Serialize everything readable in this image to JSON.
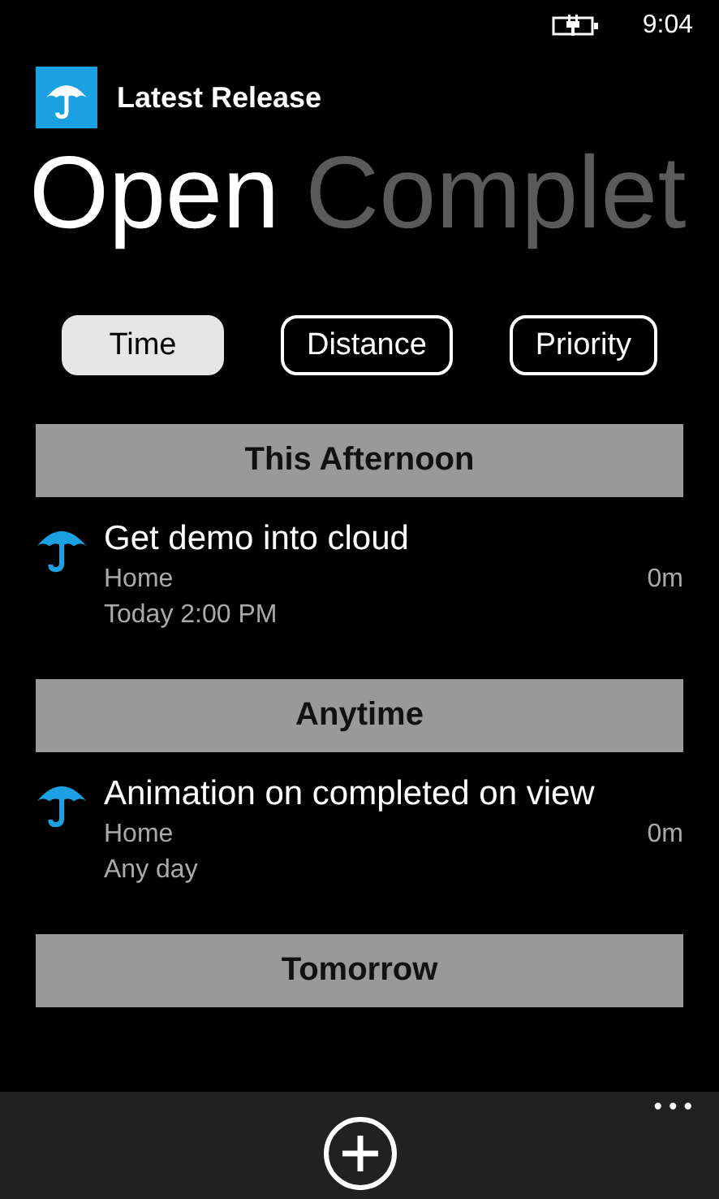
{
  "status_bar": {
    "time": "9:04"
  },
  "app": {
    "title": "Latest Release"
  },
  "pivot": [
    {
      "label": "Open",
      "selected": true
    },
    {
      "label": "Complet",
      "selected": false
    }
  ],
  "sort_buttons": [
    {
      "label": "Time",
      "selected": true
    },
    {
      "label": "Distance",
      "selected": false
    },
    {
      "label": "Priority",
      "selected": false
    }
  ],
  "groups": [
    {
      "header": "This Afternoon",
      "items": [
        {
          "title": "Get demo into cloud",
          "location": "Home",
          "distance": "0m",
          "when": "Today 2:00 PM"
        }
      ]
    },
    {
      "header": "Anytime",
      "items": [
        {
          "title": "Animation on completed on view",
          "location": "Home",
          "distance": "0m",
          "when": "Any day"
        }
      ]
    },
    {
      "header": "Tomorrow"
    }
  ],
  "app_bar": {
    "more": "•••"
  }
}
